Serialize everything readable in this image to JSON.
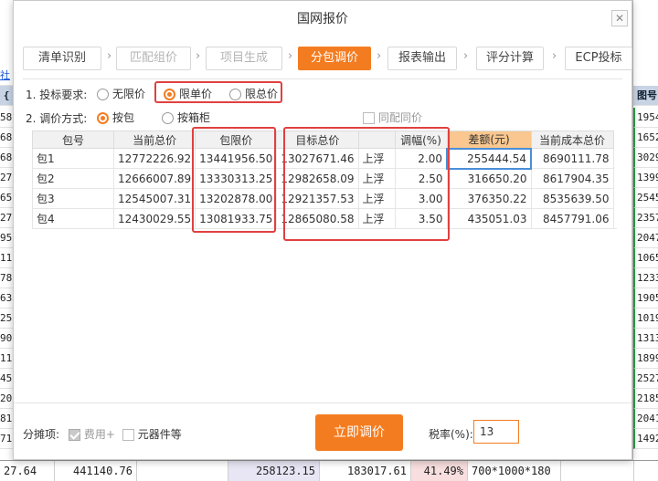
{
  "dialog": {
    "title": "国网报价",
    "close_glyph": "✕"
  },
  "steps": [
    {
      "label": "清单识别",
      "state": "normal"
    },
    {
      "label": "匹配组价",
      "state": "disabled"
    },
    {
      "label": "项目生成",
      "state": "disabled"
    },
    {
      "label": "分包调价",
      "state": "active"
    },
    {
      "label": "报表输出",
      "state": "normal"
    },
    {
      "label": "评分计算",
      "state": "normal"
    },
    {
      "label": "ECP投标",
      "state": "normal"
    }
  ],
  "step_arrow": "›",
  "bid_requirement": {
    "label": "1. 投标要求:",
    "options": [
      {
        "label": "无限价",
        "selected": false
      },
      {
        "label": "限单价",
        "selected": true
      },
      {
        "label": "限总价",
        "selected": false
      }
    ]
  },
  "adjust_method": {
    "label": "2. 调价方式:",
    "options": [
      {
        "label": "按包",
        "selected": true
      },
      {
        "label": "按箱柜",
        "selected": false
      }
    ],
    "same_match_label": "同配同价"
  },
  "table": {
    "headers": [
      "包号",
      "当前总价",
      "包限价",
      "目标总价",
      "",
      "调幅(%)",
      "差额(元)",
      "当前成本总价"
    ],
    "rows": [
      [
        "包1",
        "12772226.92",
        "13441956.50",
        "13027671.46",
        "上浮",
        "2.00",
        "255444.54",
        "8690111.78"
      ],
      [
        "包2",
        "12666007.89",
        "13330313.25",
        "12982658.09",
        "上浮",
        "2.50",
        "316650.20",
        "8617904.35"
      ],
      [
        "包3",
        "12545007.31",
        "13202878.00",
        "12921357.53",
        "上浮",
        "3.00",
        "376350.22",
        "8535639.50"
      ],
      [
        "包4",
        "12430029.55",
        "13081933.75",
        "12865080.58",
        "上浮",
        "3.50",
        "435051.03",
        "8457791.06"
      ]
    ]
  },
  "footer": {
    "allocation_label": "分摊项:",
    "fee_label": "费用+",
    "component_label": "元器件等",
    "submit_label": "立即调价",
    "tax_label": "税率(%):",
    "tax_value": "13"
  },
  "background": {
    "left_header": "{",
    "left_link": "社",
    "left_cells": [
      "58",
      "68",
      "68",
      "27",
      "65",
      "27",
      "95",
      "11",
      "78",
      "63",
      "25",
      "90",
      "11",
      "45",
      "20",
      "81",
      "71"
    ],
    "right_header": "图号",
    "right_cells": [
      "1954",
      "1652",
      "3029",
      "1399",
      "2545",
      "2357",
      "2047",
      "1065",
      "1233",
      "1905",
      "1019",
      "1313",
      "1899",
      "2527",
      "2185",
      "2041",
      "1492"
    ],
    "bottom_cells": [
      "27.64",
      "441140.76",
      "",
      "258123.15",
      "183017.61",
      "41.49%",
      "700*1000*180",
      ""
    ]
  },
  "colors": {
    "accent": "#f47c20",
    "highlight": "#e04040",
    "diff_header": "#f9c78f",
    "selection": "#4a8ed8"
  }
}
